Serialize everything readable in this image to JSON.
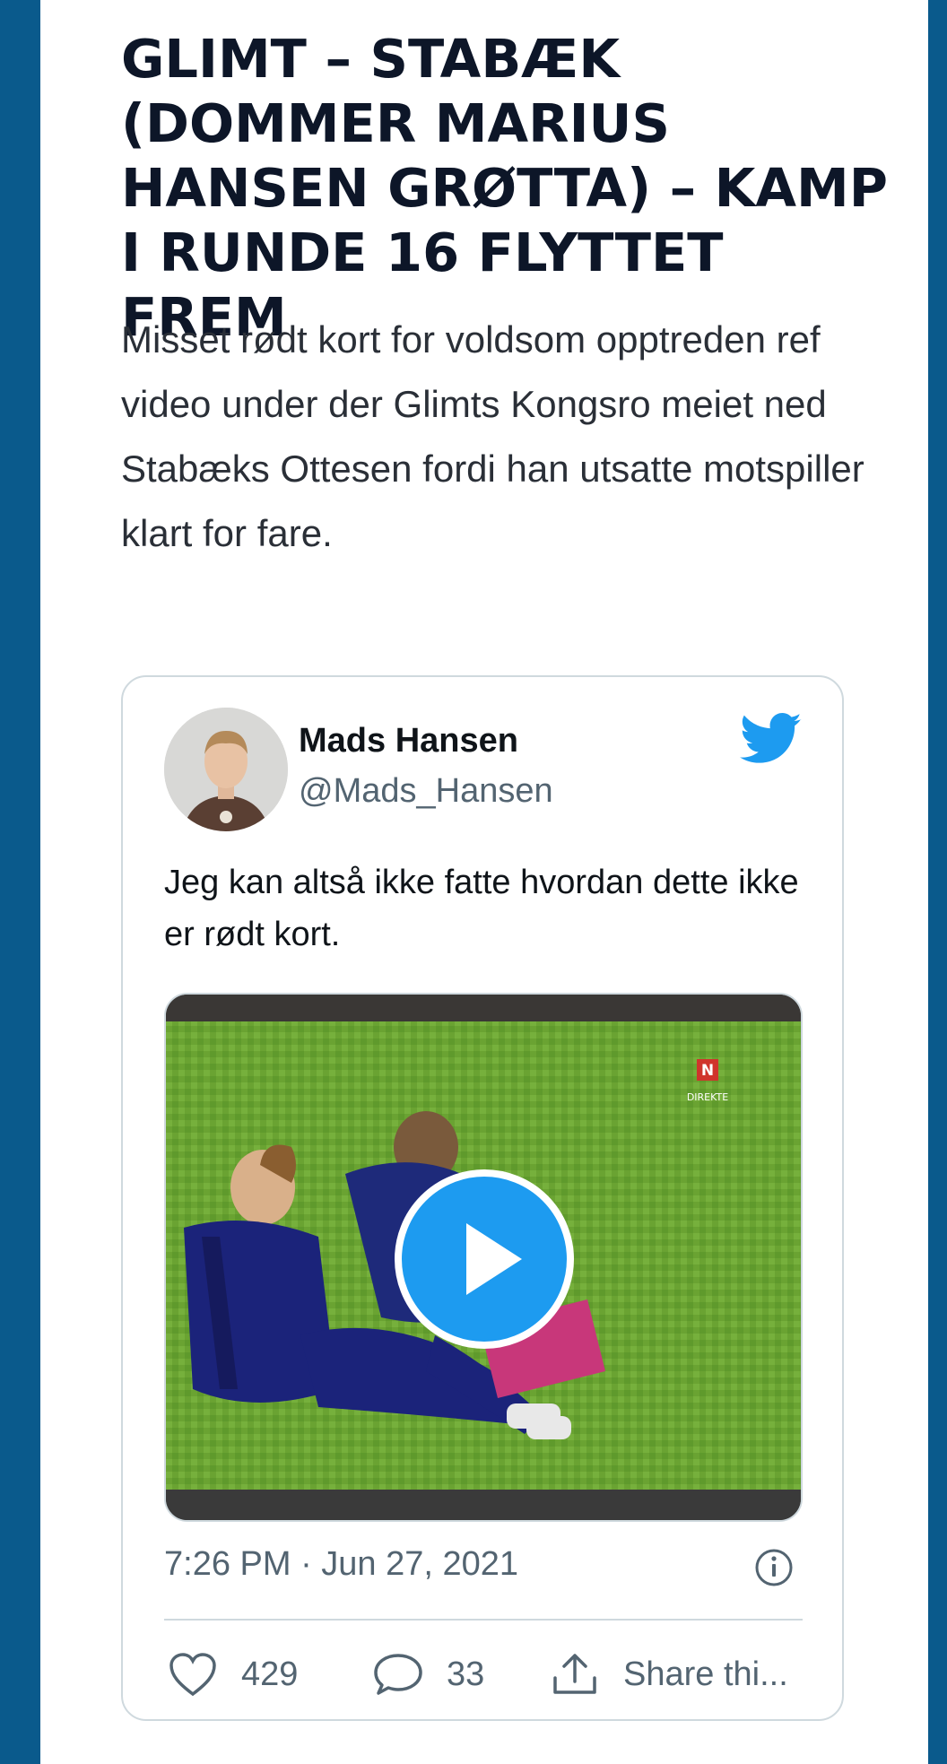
{
  "article": {
    "headline": "GLIMT – STABÆK (DOMMER MARIUS HANSEN GRØTTA) – KAMP I RUNDE 16 FLYTTET FREM",
    "lede": "Misset rødt kort for voldsom opptreden ref video under der Glimts Kongsro meiet ned Stabæks Ottesen fordi han utsatte motspiller klart for fare."
  },
  "tweet": {
    "author_name": "Mads Hansen",
    "author_handle": "@Mads_Hansen",
    "text": "Jeg kan altså ikke fatte hvordan dette ikke er rødt kort.",
    "timestamp": "7:26 PM · Jun 27, 2021",
    "likes": "429",
    "replies": "33",
    "share_label": "Share thi...",
    "media": {
      "type": "video",
      "overlay_logo": "N",
      "overlay_label": "DIREKTE"
    },
    "icons": {
      "brand": "twitter-bird-icon",
      "info": "info-icon",
      "like": "heart-icon",
      "reply": "speech-bubble-icon",
      "share": "share-upload-icon",
      "play": "play-icon"
    }
  },
  "colors": {
    "page_background": "#0a5a8c",
    "twitter_blue": "#1d9bf0",
    "headline": "#0d1628",
    "muted": "#536471"
  }
}
